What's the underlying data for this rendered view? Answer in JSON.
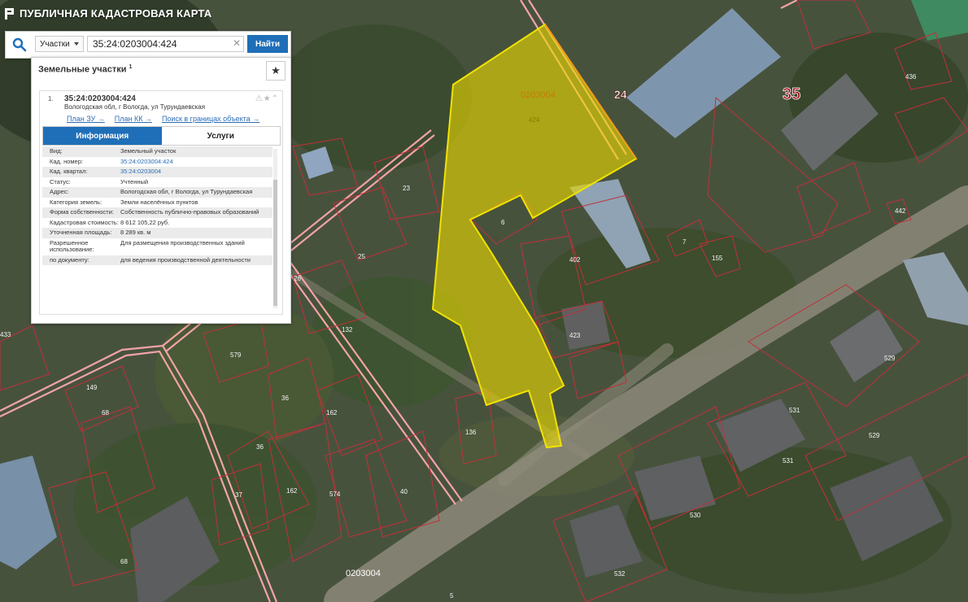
{
  "header": {
    "title": "ПУБЛИЧНАЯ КАДАСТРОВАЯ КАРТА"
  },
  "search": {
    "type_selected": "Участки",
    "query": "35:24:0203004:424",
    "button_label": "Найти",
    "clear_symbol": "✕"
  },
  "panel": {
    "title": "Земельные участки",
    "count": "1",
    "star_symbol": "★",
    "result": {
      "index": "1.",
      "number": "35:24:0203004:424",
      "address": "Вологодская обл, г Вологда, ул Турундаевская",
      "icons": "⚠★⌃",
      "links": [
        "План ЗУ →",
        "План КК →",
        "Поиск в границах объекта →"
      ],
      "tabs": [
        "Информация",
        "Услуги"
      ],
      "fields": [
        {
          "label": "Вид:",
          "value": "Земельный участок"
        },
        {
          "label": "Кад. номер:",
          "value": "35:24:0203004:424"
        },
        {
          "label": "Кад. квартал:",
          "value": "35:24:0203004"
        },
        {
          "label": "Статус:",
          "value": "Учтенный"
        },
        {
          "label": "Адрес:",
          "value": "Вологодская обл, г Вологда, ул Турундаевская"
        },
        {
          "label": "Категория земель:",
          "value": "Земли населённых пунктов"
        },
        {
          "label": "Форма собственности:",
          "value": "Собственность публично-правовых образований"
        },
        {
          "label": "Кадастровая стоимость:",
          "value": "8 612 105,22 руб."
        },
        {
          "label": "Уточненная площадь:",
          "value": "8 289 кв. м"
        },
        {
          "label": "Разрешенное использование:",
          "value": "Для размещения производственных зданий"
        },
        {
          "label": "по документу:",
          "value": "для ведения производственной деятельности"
        }
      ]
    }
  },
  "map": {
    "highlight_color": "#e8d800",
    "boundary_color": "#c0303a",
    "quarter_color": "#f3a3a8",
    "labels": {
      "quarter_24": "24",
      "quarter_35": "35",
      "block_top": "0203004",
      "block_bottom": "0203004",
      "parcel": "424",
      "l6": "6",
      "l7": "7",
      "l155": "155",
      "l402": "402",
      "l423": "423",
      "l436": "436",
      "l529a": "529",
      "l529b": "529",
      "l531a": "531",
      "l531b": "531",
      "l530": "530",
      "l532": "532",
      "l23": "23",
      "l25": "25",
      "l26": "26",
      "l132": "132",
      "l579": "579",
      "l36a": "36",
      "l36b": "36",
      "l162a": "162",
      "l162b": "162",
      "l574": "574",
      "l40": "40",
      "l37": "37",
      "l136": "136",
      "l149": "149",
      "l68a": "68",
      "l68b": "68",
      "l433": "433",
      "l5": "5",
      "l442": "442"
    }
  }
}
